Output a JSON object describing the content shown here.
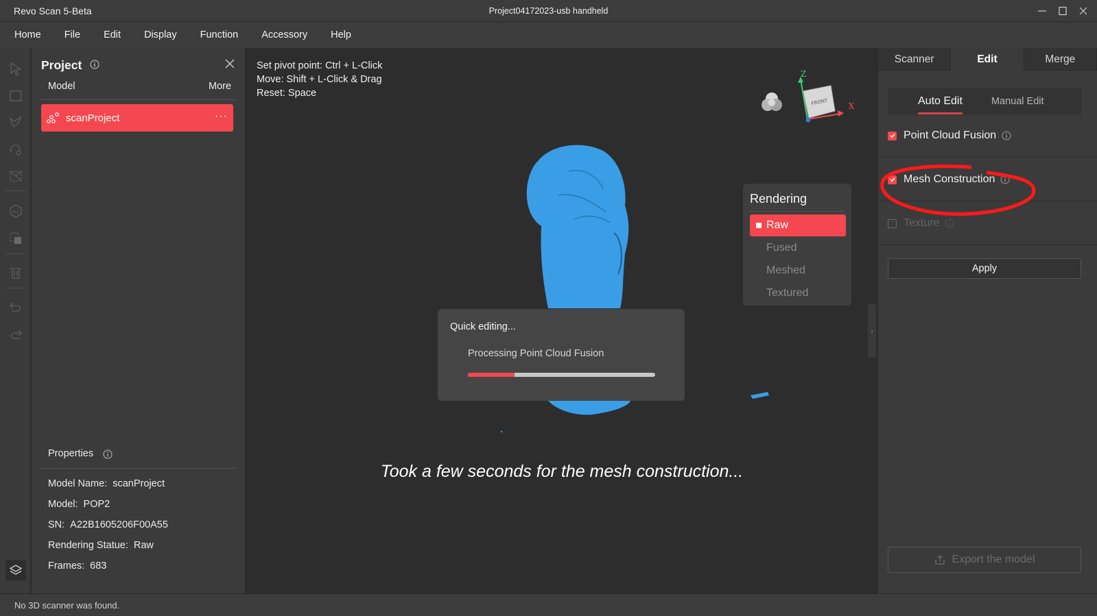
{
  "window": {
    "app_title": "Revo Scan 5-Beta",
    "document_title": "Project04172023-usb handheld"
  },
  "menu": [
    "Home",
    "File",
    "Edit",
    "Display",
    "Function",
    "Accessory",
    "Help"
  ],
  "toolstrip": {
    "tools": [
      "select-arrow",
      "rectangle-select",
      "lasso-select",
      "brush-select",
      "invert-select",
      "reset-view",
      "crop-select",
      "delete",
      "undo",
      "redo"
    ],
    "bottom": "layers"
  },
  "project_panel": {
    "title": "Project",
    "columns": {
      "model": "Model",
      "more": "More"
    },
    "models": [
      {
        "name": "scanProject",
        "menu": "···"
      }
    ],
    "properties": {
      "title": "Properties",
      "rows": [
        {
          "label": "Model Name:",
          "value": "scanProject"
        },
        {
          "label": "Model:",
          "value": "POP2"
        },
        {
          "label": "SN:",
          "value": "A22B1605206F00A55"
        },
        {
          "label": "Rendering Statue:",
          "value": "Raw"
        },
        {
          "label": "Frames:",
          "value": "683"
        }
      ]
    }
  },
  "viewport": {
    "hints": [
      "Set pivot point: Ctrl + L-Click",
      "Move: Shift + L-Click & Drag",
      "Reset: Space"
    ],
    "view_cube": {
      "face": "FRONT",
      "axis_z": "Z",
      "axis_x": "X"
    },
    "rendering": {
      "title": "Rendering",
      "options": [
        {
          "label": "Raw",
          "active": true
        },
        {
          "label": "Fused",
          "active": false
        },
        {
          "label": "Meshed",
          "active": false
        },
        {
          "label": "Textured",
          "active": false
        }
      ]
    },
    "dialog": {
      "title": "Quick editing...",
      "message": "Processing Point Cloud Fusion",
      "progress": 0.25
    },
    "caption": "Took a few seconds for the mesh construction...",
    "model_color": "#3a9ee6"
  },
  "right_panel": {
    "tabs": [
      {
        "label": "Scanner",
        "active": false
      },
      {
        "label": "Edit",
        "active": true
      },
      {
        "label": "Merge",
        "active": false
      }
    ],
    "subtabs": [
      {
        "label": "Auto Edit",
        "active": true
      },
      {
        "label": "Manual Edit",
        "active": false
      }
    ],
    "options": [
      {
        "label": "Point Cloud Fusion",
        "checked": true,
        "enabled": true
      },
      {
        "label": "Mesh Construction",
        "checked": true,
        "enabled": true
      },
      {
        "label": "Texture",
        "checked": false,
        "enabled": false
      }
    ],
    "apply_label": "Apply",
    "export_label": "Export the model"
  },
  "status": {
    "text": "No 3D scanner was found."
  },
  "colors": {
    "accent": "#f5474f",
    "annotation": "#ff1a1a"
  }
}
